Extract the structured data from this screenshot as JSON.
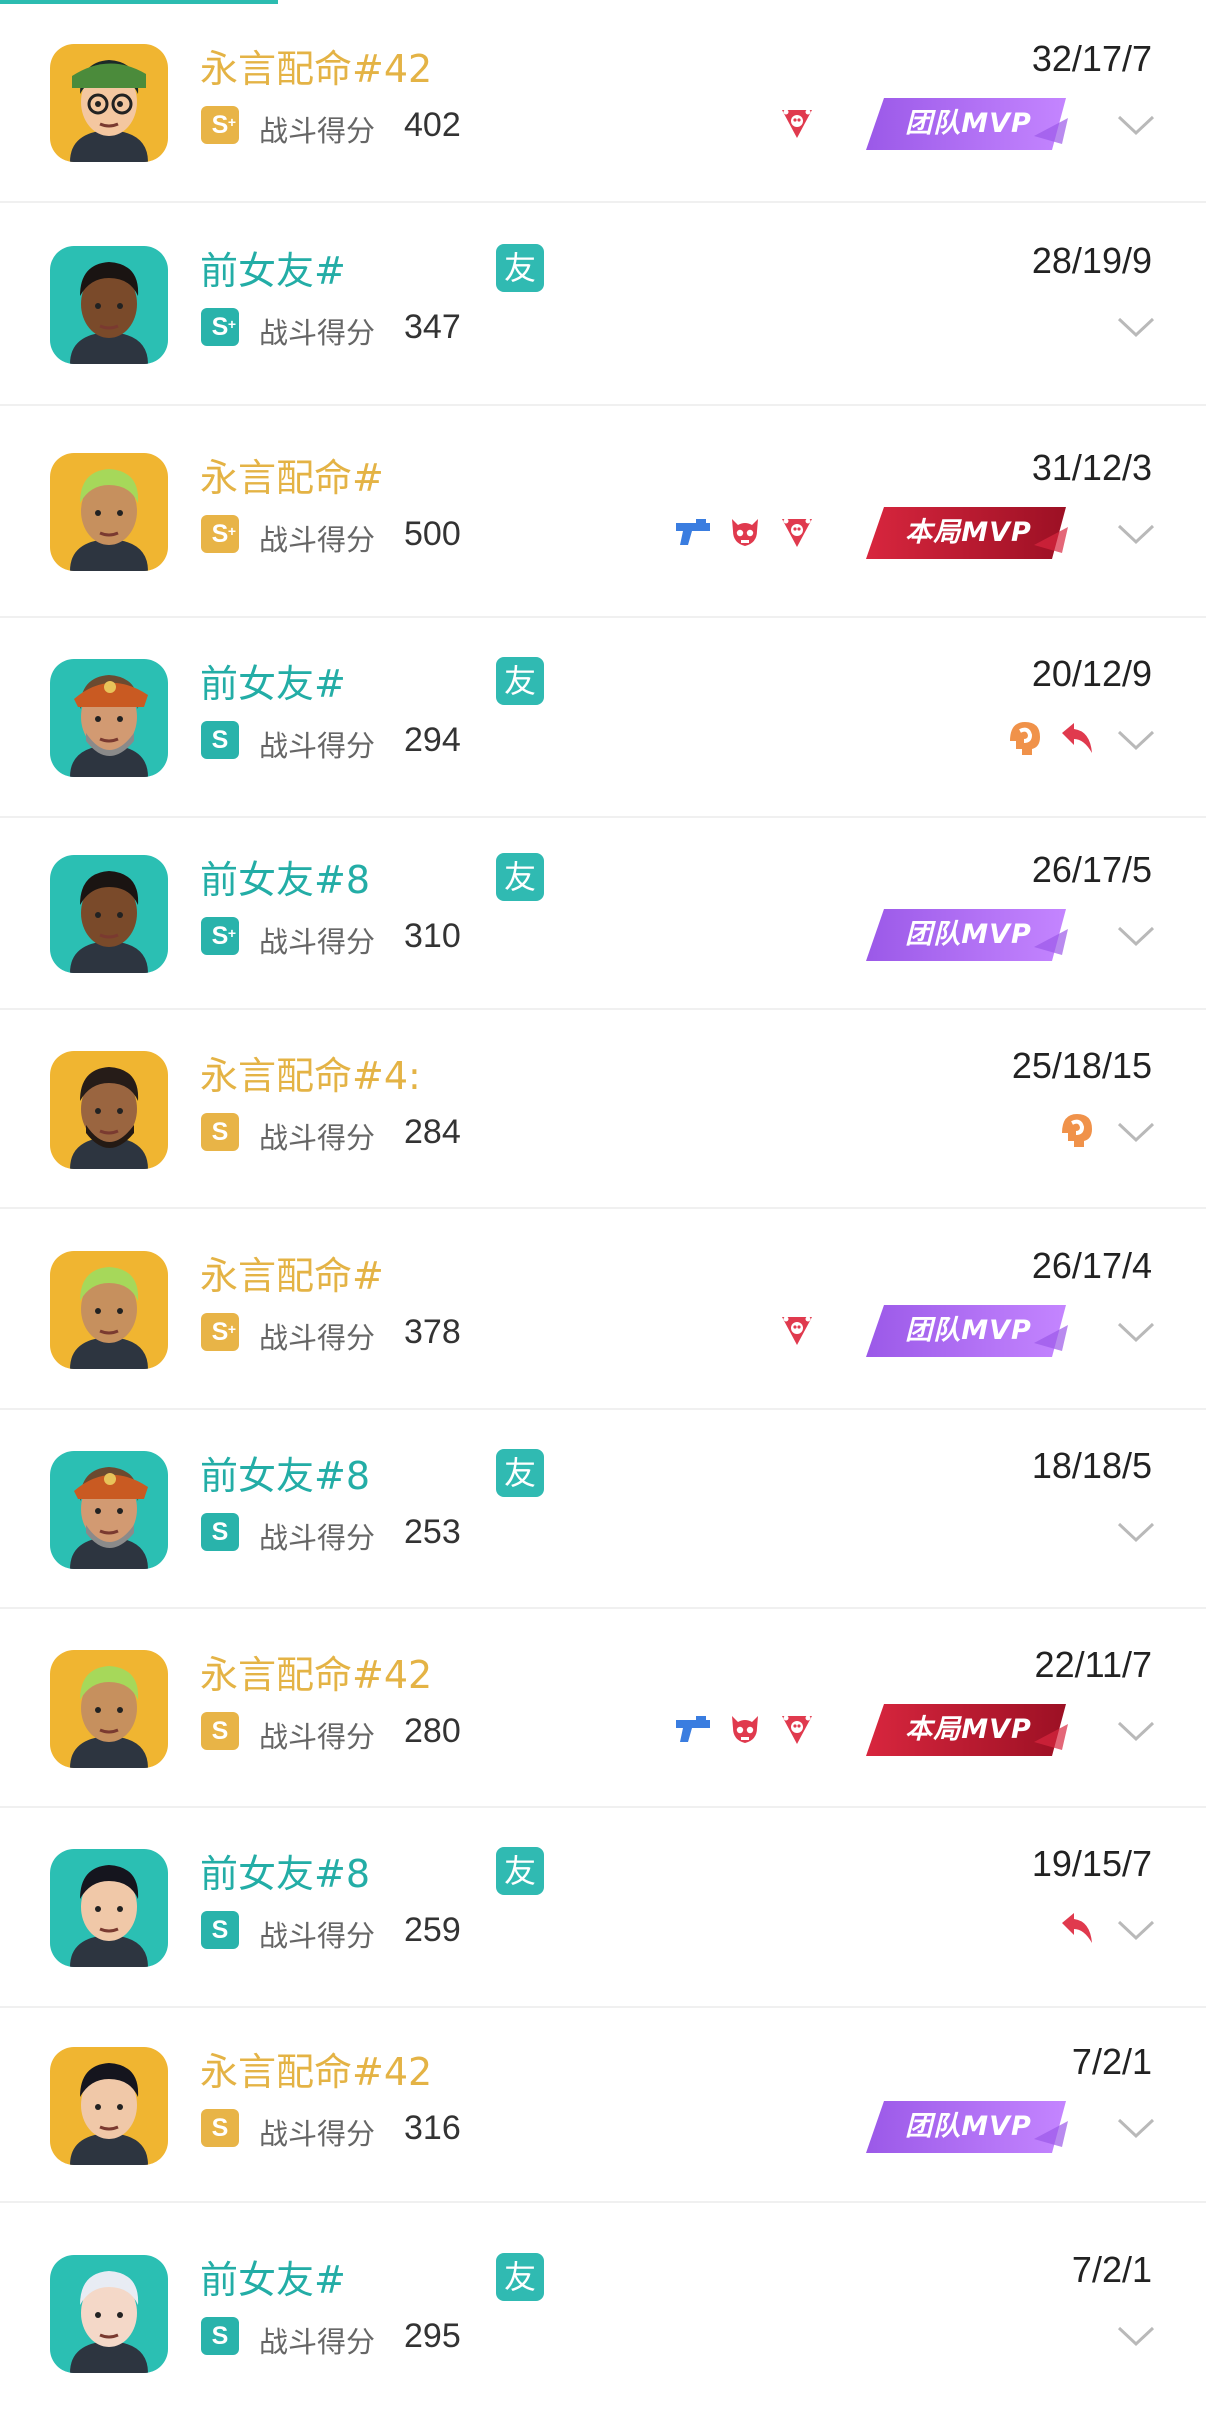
{
  "players": [
    {
      "name": "永言配命#42",
      "team": "yellow",
      "friend": false,
      "rank": "S",
      "rank_plus": true,
      "score_label": "战斗得分",
      "score": "402",
      "kda": "32/17/7",
      "achievements": [
        "skull-triangle-icon"
      ],
      "mvp": "团队MVP",
      "mvp_type": "team",
      "agent": "killjoy"
    },
    {
      "name": "前女友#",
      "team": "teal",
      "friend": true,
      "rank": "S",
      "rank_plus": true,
      "score_label": "战斗得分",
      "score": "347",
      "kda": "28/19/9",
      "achievements": [],
      "mvp": "",
      "mvp_type": "",
      "agent": "phoenix"
    },
    {
      "name": "永言配命#",
      "team": "yellow",
      "friend": false,
      "rank": "S",
      "rank_plus": true,
      "score_label": "战斗得分",
      "score": "500",
      "kda": "31/12/3",
      "achievements": [
        "pistol-icon",
        "demon-skull-icon",
        "skull-triangle-icon"
      ],
      "mvp": "本局MVP",
      "mvp_type": "match",
      "agent": "neon-blond"
    },
    {
      "name": "前女友#",
      "team": "teal",
      "friend": true,
      "rank": "S",
      "rank_plus": false,
      "score_label": "战斗得分",
      "score": "294",
      "kda": "20/12/9",
      "achievements": [
        "clutch-icon",
        "return-arrow-icon"
      ],
      "mvp": "",
      "mvp_type": "",
      "agent": "brimstone"
    },
    {
      "name": "前女友#8",
      "team": "teal",
      "friend": true,
      "rank": "S",
      "rank_plus": true,
      "score_label": "战斗得分",
      "score": "310",
      "kda": "26/17/5",
      "achievements": [],
      "mvp": "团队MVP",
      "mvp_type": "team",
      "agent": "phoenix"
    },
    {
      "name": "永言配命#4:",
      "team": "yellow",
      "friend": false,
      "rank": "S",
      "rank_plus": false,
      "score_label": "战斗得分",
      "score": "284",
      "kda": "25/18/15",
      "achievements": [
        "clutch-icon"
      ],
      "mvp": "",
      "mvp_type": "",
      "agent": "harbor"
    },
    {
      "name": "永言配命#",
      "team": "yellow",
      "friend": false,
      "rank": "S",
      "rank_plus": true,
      "score_label": "战斗得分",
      "score": "378",
      "kda": "26/17/4",
      "achievements": [
        "skull-triangle-icon"
      ],
      "mvp": "团队MVP",
      "mvp_type": "team",
      "agent": "neon-blond"
    },
    {
      "name": "前女友#8",
      "team": "teal",
      "friend": true,
      "rank": "S",
      "rank_plus": false,
      "score_label": "战斗得分",
      "score": "253",
      "kda": "18/18/5",
      "achievements": [],
      "mvp": "",
      "mvp_type": "",
      "agent": "brimstone"
    },
    {
      "name": "永言配命#42",
      "team": "yellow",
      "friend": false,
      "rank": "S",
      "rank_plus": false,
      "score_label": "战斗得分",
      "score": "280",
      "kda": "22/11/7",
      "achievements": [
        "pistol-icon",
        "demon-skull-icon",
        "skull-triangle-icon"
      ],
      "mvp": "本局MVP",
      "mvp_type": "match",
      "agent": "neon-blond"
    },
    {
      "name": "前女友#8",
      "team": "teal",
      "friend": true,
      "rank": "S",
      "rank_plus": false,
      "score_label": "战斗得分",
      "score": "259",
      "kda": "19/15/7",
      "achievements": [
        "return-arrow-icon"
      ],
      "mvp": "",
      "mvp_type": "",
      "agent": "sage"
    },
    {
      "name": "永言配命#42",
      "team": "yellow",
      "friend": false,
      "rank": "S",
      "rank_plus": false,
      "score_label": "战斗得分",
      "score": "316",
      "kda": "7/2/1",
      "achievements": [],
      "mvp": "团队MVP",
      "mvp_type": "team",
      "agent": "sage"
    },
    {
      "name": "前女友#",
      "team": "teal",
      "friend": true,
      "rank": "S",
      "rank_plus": false,
      "score_label": "战斗得分",
      "score": "295",
      "kda": "7/2/1",
      "achievements": [],
      "mvp": "",
      "mvp_type": "",
      "agent": "jett"
    }
  ],
  "friend_label": "友",
  "colors": {
    "yellow_team": "#e4b345",
    "teal_team": "#23ada6",
    "friend_badge": "#30bab2",
    "team_mvp": "#9b59e8",
    "match_mvp": "#d8263e",
    "achievement_red": "#e03a4e",
    "achievement_orange": "#f0924a",
    "achievement_blue": "#3a7de0"
  }
}
